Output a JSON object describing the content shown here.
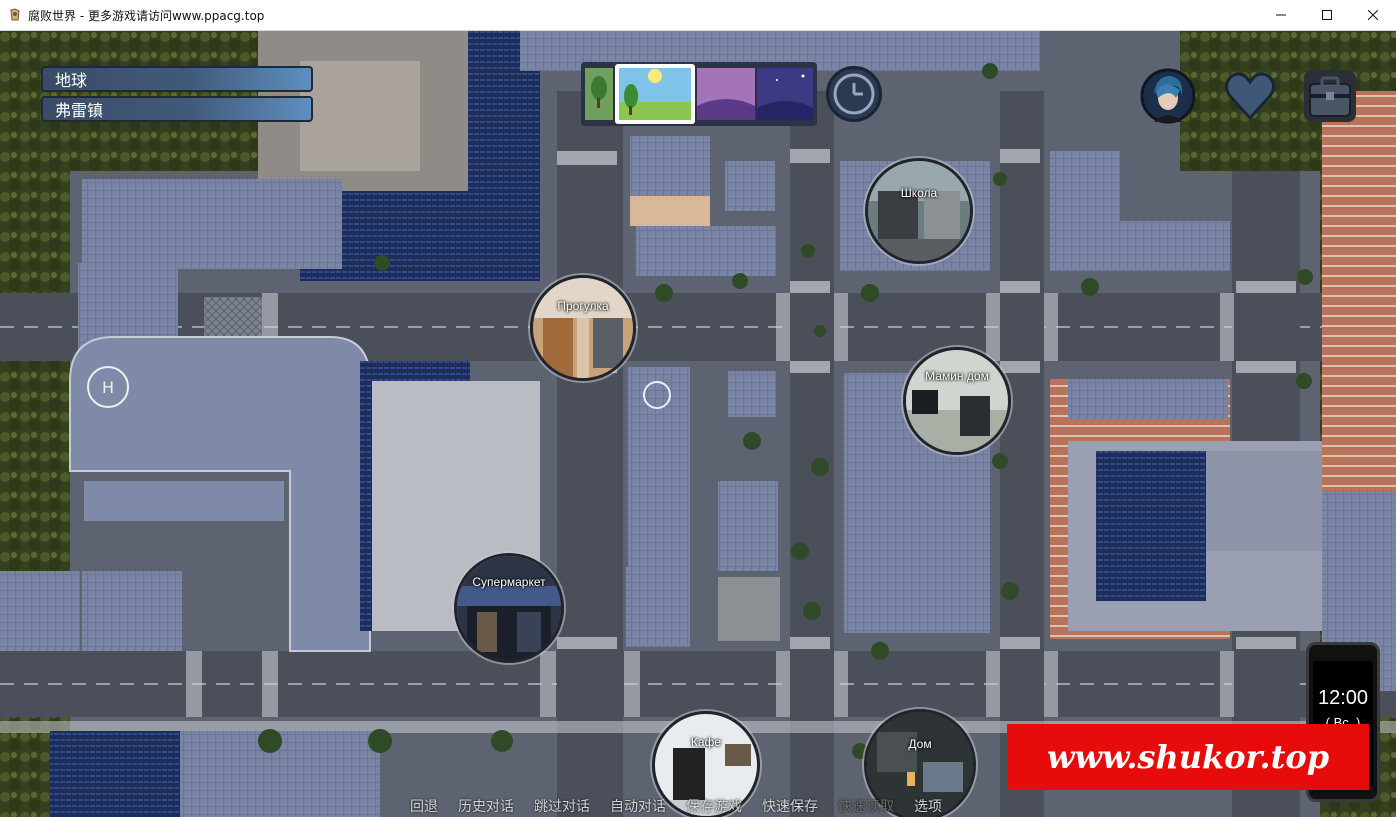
{
  "window": {
    "title": "腐败世界 - 更多游戏请访问www.ppacg.top",
    "app_icon": "game-app-icon",
    "controls": [
      "minimize",
      "maximize",
      "close"
    ]
  },
  "location": {
    "world": "地球",
    "town": "弗雷镇"
  },
  "time_of_day": {
    "options": [
      "day",
      "noon",
      "evening",
      "night"
    ],
    "selected": "noon"
  },
  "top_buttons": [
    "clock-icon",
    "character-portrait",
    "heart-icon",
    "inventory-bag-icon"
  ],
  "markers": [
    {
      "id": "school",
      "label": "Школа"
    },
    {
      "id": "walk",
      "label": "Прогулка"
    },
    {
      "id": "mom-home",
      "label": "Мамин дом"
    },
    {
      "id": "supermarket",
      "label": "Супермаркет"
    },
    {
      "id": "cafe",
      "label": "Кафе"
    },
    {
      "id": "home",
      "label": "Дом"
    }
  ],
  "phone": {
    "time": "12:00",
    "day": "( Вс. )"
  },
  "watermark": "www.shukor.top",
  "quick_menu": [
    {
      "label": "回退",
      "enabled": true
    },
    {
      "label": "历史对话",
      "enabled": true
    },
    {
      "label": "跳过对话",
      "enabled": true
    },
    {
      "label": "自动对话",
      "enabled": true
    },
    {
      "label": "保存游戏",
      "enabled": true
    },
    {
      "label": "快速保存",
      "enabled": true
    },
    {
      "label": "快速读取",
      "enabled": false
    },
    {
      "label": "选项",
      "enabled": true
    }
  ],
  "colors": {
    "road": "#4a4f5a",
    "roof": "#6a7590",
    "grass": "#3d4a2a",
    "label_bar": "#415a7a",
    "watermark_bg": "#e80b0b"
  }
}
